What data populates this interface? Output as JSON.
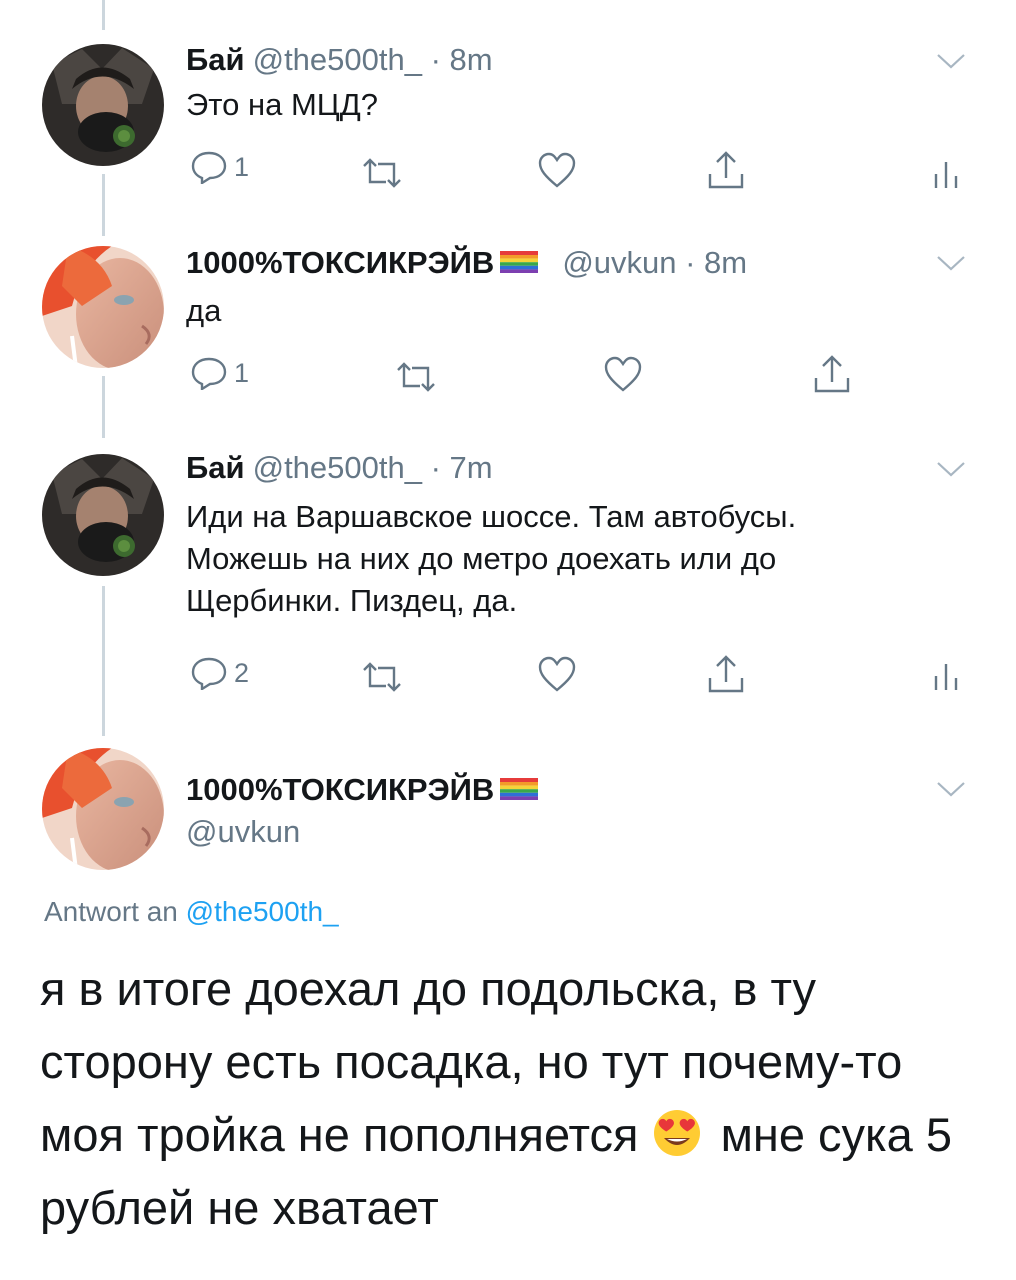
{
  "colors": {
    "text": "#14171a",
    "meta": "#657786",
    "link": "#1da1f2",
    "line": "#ccd6dd"
  },
  "tweets": [
    {
      "name": "Бай",
      "handle_meta": "@the500th_ · 8m",
      "text": "Это на МЦД?",
      "reply_count": "1",
      "show_analytics": true
    },
    {
      "name": "1000%ТОКСИКРЭЙВ",
      "flag": "rainbow-flag",
      "handle_meta": "@uvkun · 8m",
      "text": "да",
      "reply_count": "1",
      "show_analytics": false
    },
    {
      "name": "Бай",
      "handle_meta": "@the500th_ · 7m",
      "text_lines": [
        "Иди на Варшавское шоссе. Там автобусы.",
        "Можешь на них до метро доехать или до",
        "Щербинки. Пиздец, да."
      ],
      "reply_count": "2",
      "show_analytics": true
    }
  ],
  "focused_tweet": {
    "name": "1000%ТОКСИКРЭЙВ",
    "flag": "rainbow-flag",
    "handle": "@uvkun",
    "reply_prefix": "Antwort an ",
    "reply_mention": "@the500th_",
    "text_part1": "я в итоге доехал до подольска, в ту сторону есть посадка, но тут почему-то моя тройка не пополняется ",
    "emoji": "smiling-face-with-heart-eyes",
    "text_part2": " мне сука 5 рублей не хватает"
  },
  "icons": [
    "reply-icon",
    "retweet-icon",
    "like-icon",
    "share-icon",
    "analytics-icon",
    "caret-down-icon"
  ]
}
